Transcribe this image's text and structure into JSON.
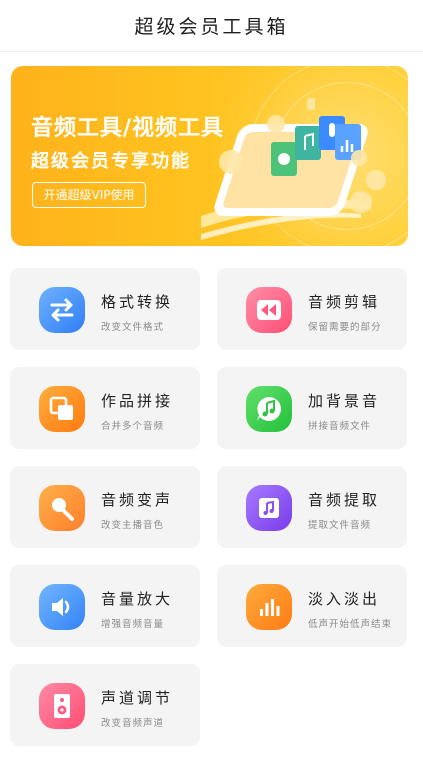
{
  "header": {
    "title": "超级会员工具箱"
  },
  "banner": {
    "title": "音频工具/视频工具",
    "subtitle": "超级会员专享功能",
    "cta": "开通超级VIP使用"
  },
  "tools": [
    {
      "name": "格式转换",
      "desc": "改变文件格式",
      "icon": "swap-arrows-icon"
    },
    {
      "name": "音频剪辑",
      "desc": "保留需要的部分",
      "icon": "rewind-icon"
    },
    {
      "name": "作品拼接",
      "desc": "合并多个音频",
      "icon": "overlap-squares-icon"
    },
    {
      "name": "加背景音",
      "desc": "拼接音频文件",
      "icon": "music-bubble-icon"
    },
    {
      "name": "音频变声",
      "desc": "改变主播音色",
      "icon": "microphone-icon"
    },
    {
      "name": "音频提取",
      "desc": "提取文件音频",
      "icon": "music-note-icon"
    },
    {
      "name": "音量放大",
      "desc": "增强音频音量",
      "icon": "speaker-icon"
    },
    {
      "name": "淡入淡出",
      "desc": "低声开始低声结束",
      "icon": "bars-icon"
    },
    {
      "name": "声道调节",
      "desc": "改变音频声道",
      "icon": "loudspeaker-icon"
    }
  ],
  "colors": {
    "banner": "#ffc21f",
    "card_bg": "#f4f4f4",
    "blue": "#3b8bff",
    "pink": "#ff5a7f",
    "orange": "#ff8a1e",
    "green": "#39d34a",
    "purple": "#8c4ff0"
  }
}
